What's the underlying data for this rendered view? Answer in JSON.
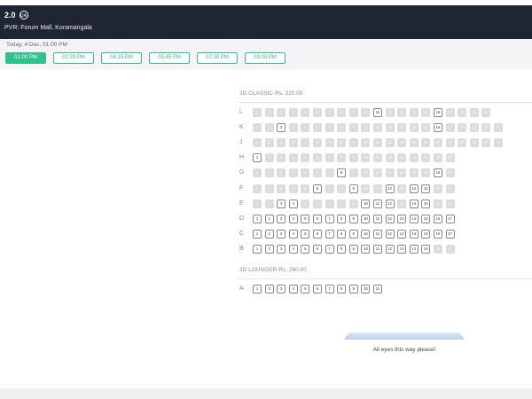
{
  "header": {
    "title": "2.0",
    "certificate": "UA",
    "venue": "PVR: Forum Mall, Koramangala"
  },
  "showtimes": {
    "date_label": "Today, 4 Dec, 01:00 PM",
    "times": [
      "01:00 PM",
      "02:30 PM",
      "04:15 PM",
      "05:45 PM",
      "07:30 PM",
      "09:00 PM"
    ],
    "selected": "01:00 PM"
  },
  "colors": {
    "accent": "#2dc38a",
    "header_bg": "#1f2533",
    "sold_seat": "#dcdcdc"
  },
  "sections": [
    {
      "label": "3D CLASSIC-Rs. 220.00",
      "rows": [
        {
          "label": "L",
          "seats": 20,
          "available": [
            11,
            16
          ]
        },
        {
          "label": "K",
          "seats": 21,
          "available": [
            3,
            16
          ]
        },
        {
          "label": "J",
          "seats": 21,
          "available": []
        },
        {
          "label": "H",
          "seats": 17,
          "available": [
            1
          ]
        },
        {
          "label": "G",
          "seats": 17,
          "available": [
            8,
            16
          ]
        },
        {
          "label": "F",
          "seats": 17,
          "available": [
            6,
            9,
            12,
            14,
            15
          ]
        },
        {
          "label": "E",
          "seats": 17,
          "available": [
            3,
            4,
            10,
            11,
            12,
            14,
            15
          ]
        },
        {
          "label": "D",
          "seats": 17,
          "available": [
            1,
            2,
            3,
            4,
            5,
            6,
            7,
            8,
            9,
            10,
            11,
            12,
            13,
            14,
            15,
            16,
            17
          ]
        },
        {
          "label": "C",
          "seats": 17,
          "available": [
            1,
            2,
            3,
            4,
            5,
            6,
            7,
            8,
            9,
            10,
            11,
            12,
            13,
            14,
            15,
            16,
            17
          ]
        },
        {
          "label": "B",
          "seats": 17,
          "available": [
            1,
            2,
            3,
            4,
            5,
            6,
            7,
            8,
            9,
            10,
            11,
            12,
            13,
            14,
            15
          ]
        }
      ]
    },
    {
      "label": "3D LOUNGER-Rs. 260.00",
      "rows": [
        {
          "label": "A",
          "seats": 11,
          "available": [
            1,
            2,
            3,
            4,
            5,
            6,
            7,
            8,
            9,
            10,
            11
          ]
        }
      ]
    }
  ],
  "screen_text": "All eyes this way please!"
}
